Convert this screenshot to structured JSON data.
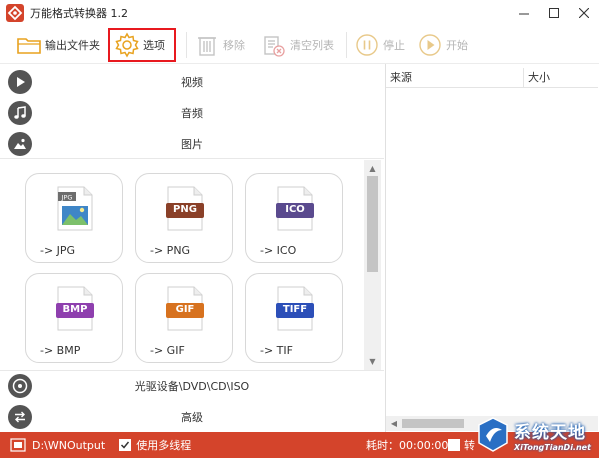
{
  "window": {
    "title": "万能格式转换器 1.2"
  },
  "toolbar": {
    "output_folder": "输出文件夹",
    "options": "选项",
    "remove": "移除",
    "clear_list": "清空列表",
    "stop": "停止",
    "start": "开始"
  },
  "categories": {
    "video": "视频",
    "audio": "音频",
    "image": "图片",
    "disc": "光驱设备\\DVD\\CD\\ISO",
    "advanced": "高级"
  },
  "formats": [
    {
      "badge": "JPG",
      "label": "-> JPG",
      "color": "#6d6d6d"
    },
    {
      "badge": "PNG",
      "label": "-> PNG",
      "color": "#8a4028"
    },
    {
      "badge": "ICO",
      "label": "-> ICO",
      "color": "#5a4a8e"
    },
    {
      "badge": "BMP",
      "label": "-> BMP",
      "color": "#8e3fae"
    },
    {
      "badge": "GIF",
      "label": "-> GIF",
      "color": "#d7721f"
    },
    {
      "badge": "TIFF",
      "label": "-> TIF",
      "color": "#2c4fb8"
    }
  ],
  "file_list": {
    "col_source": "来源",
    "col_size": "大小"
  },
  "statusbar": {
    "output_path": "D:\\WNOutput",
    "multithread": "使用多线程",
    "elapsed": "耗时：00:00:00",
    "after_prefix": "转"
  },
  "watermark": {
    "main": "系统天地",
    "sub": "XiTongTianDi.net"
  },
  "colors": {
    "statusbar": "#d4442b",
    "highlight": "#e8191f",
    "accent": "#e8a21f"
  }
}
